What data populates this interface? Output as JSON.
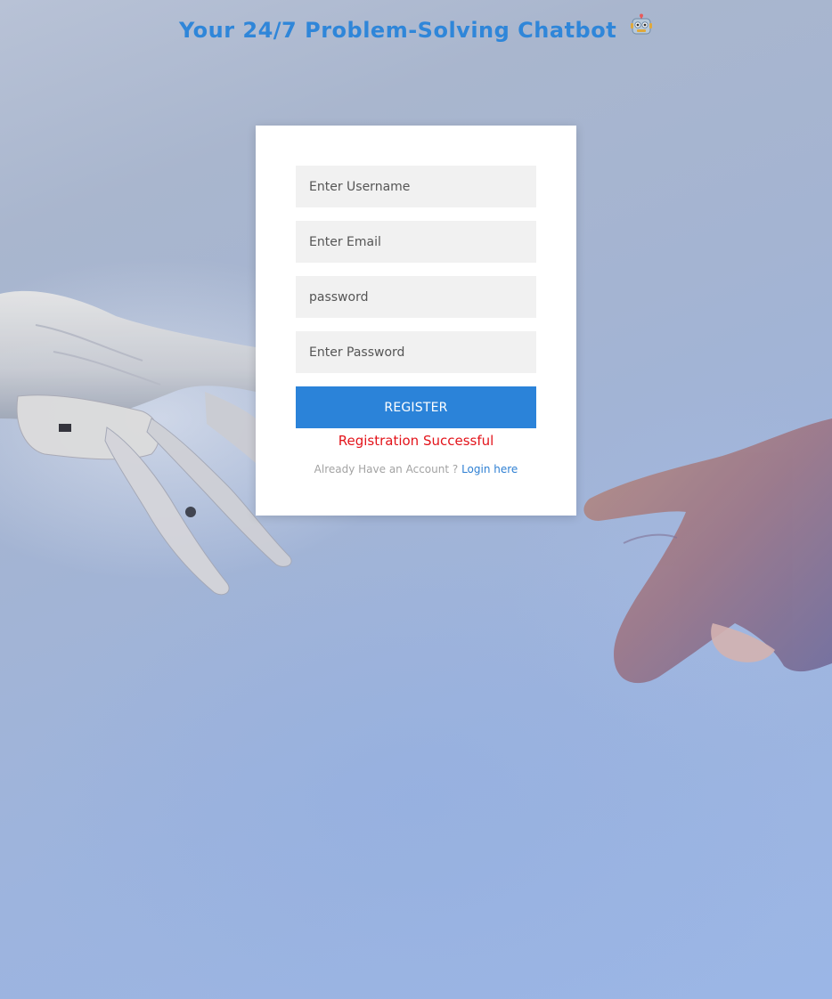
{
  "header": {
    "title": "Your 24/7 Problem-Solving Chatbot",
    "title_icon": "robot-icon"
  },
  "form": {
    "username_placeholder": "Enter Username",
    "email_placeholder": "Enter Email",
    "password_placeholder": "password",
    "confirm_password_placeholder": "Enter Password",
    "register_label": "REGISTER",
    "status_message": "Registration Successful",
    "login_prompt": "Already Have an Account ?",
    "login_link": "Login here"
  },
  "colors": {
    "accent": "#2b83d9",
    "title": "#2f86d9",
    "status_error": "#e3141b"
  }
}
